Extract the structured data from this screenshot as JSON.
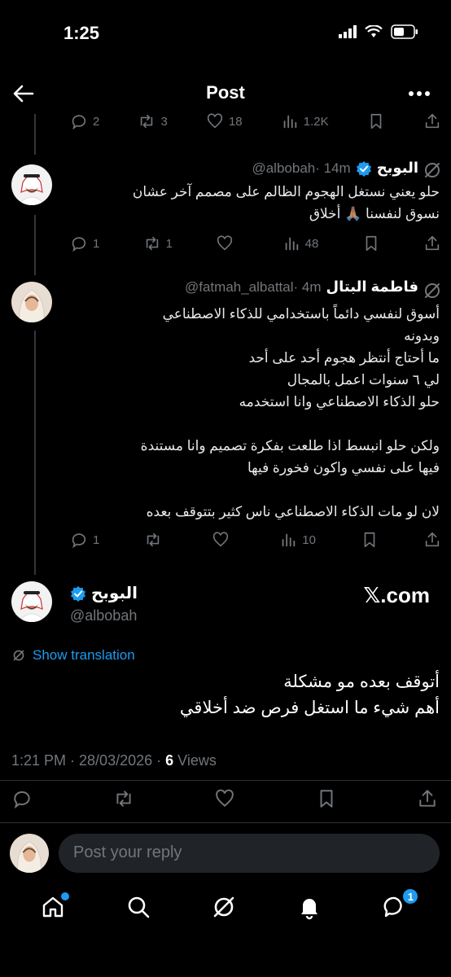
{
  "status_bar": {
    "time": "1:25"
  },
  "header": {
    "title": "Post"
  },
  "top_actions": {
    "replies": "2",
    "reposts": "3",
    "likes": "18",
    "views": "1.2K"
  },
  "tweets": [
    {
      "name": "البوبح",
      "handle": "@albobah",
      "time": "· 14m",
      "text": "حلو يعني نستغل الهجوم الظالم على مصمم آخر عشان\nنسوق لنفسنا 🙏🏽 أخلاق",
      "replies": "1",
      "reposts": "1",
      "likes": "",
      "views": "48"
    },
    {
      "name": "فاطمة البتال",
      "handle": "@fatmah_albattal",
      "time": "· 4m",
      "text": "أسوق لنفسي دائماً باستخدامي للذكاء الاصطناعي\nوبدونه\nما أحتاج أنتظر هجوم أحد على أحد\nلي ٦ سنوات اعمل بالمجال\nحلو الذكاء الاصطناعي وانا استخدمه\n\nولكن حلو انبسط اذا طلعت بفكرة تصميم وانا مستندة\nفيها على نفسي واكون فخورة فيها\n\nلان لو مات الذكاء الاصطناعي ناس كثير بتتوقف بعده",
      "replies": "1",
      "reposts": "",
      "likes": "",
      "views": "10"
    }
  ],
  "main_tweet": {
    "name": "البوبح",
    "handle": "@albobah",
    "source": "𝕏.com",
    "show_translation": "Show translation",
    "line1": "أتوقف بعده مو مشكلة",
    "line2": "أهم شيء ما استغل فرص ضد أخلاقي",
    "timestamp": "1:21 PM · 28/03/2026 · ",
    "views_count": "6",
    "views_label": " Views"
  },
  "reply": {
    "placeholder": "Post your reply"
  },
  "nav": {
    "messages_badge": "1"
  },
  "colors": {
    "accent": "#1d9bf0",
    "muted": "#71767b",
    "background": "#000000"
  }
}
